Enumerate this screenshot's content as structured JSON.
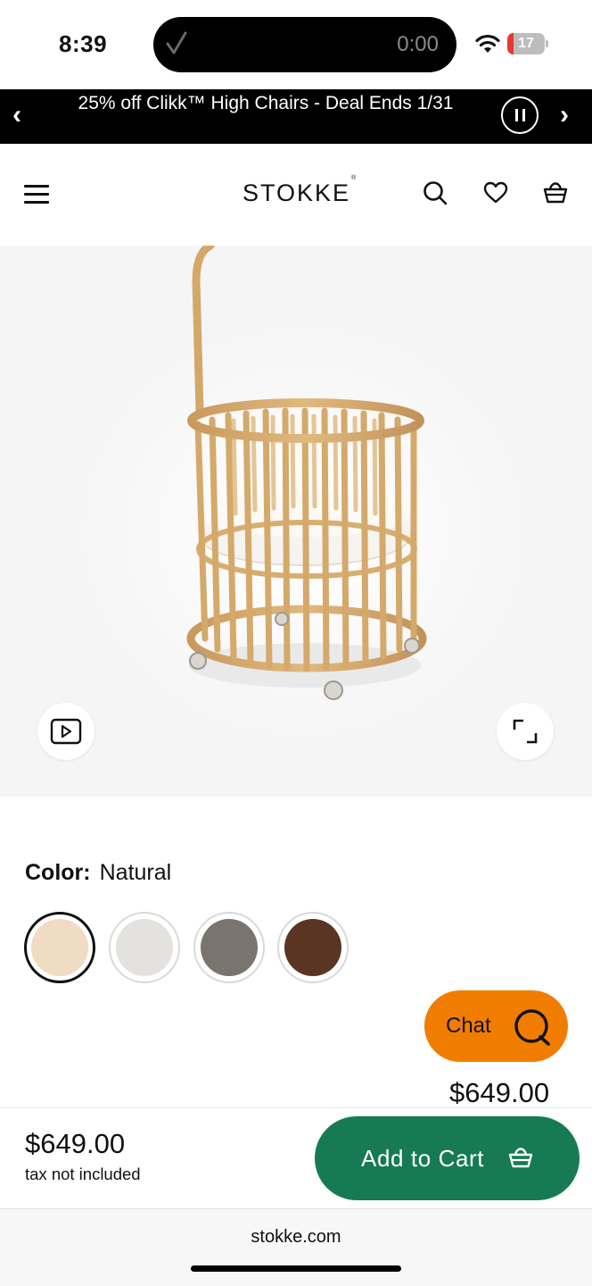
{
  "status_bar": {
    "time": "8:39",
    "timer": "0:00",
    "battery_level": "17",
    "battery_fraction": 0.17,
    "icons": [
      "checkmark-icon",
      "wifi-icon",
      "battery-icon"
    ]
  },
  "promo": {
    "text": "25% off Clikk™ High Chairs - Deal Ends 1/31",
    "prev_icon": "‹",
    "next_icon": "›"
  },
  "header": {
    "logo": "STOKKE",
    "logo_mark": "®",
    "icons": [
      "menu-icon",
      "search-icon",
      "heart-icon",
      "basket-icon"
    ]
  },
  "product": {
    "image_alt": "round wooden crib with canopy pole",
    "color_label": "Color:",
    "color_value": "Natural",
    "swatches": [
      {
        "name": "Natural",
        "color": "#f0dcc2",
        "selected": true
      },
      {
        "name": "White",
        "color": "#e4e2df",
        "selected": false
      },
      {
        "name": "Grey",
        "color": "#7a746e",
        "selected": false
      },
      {
        "name": "Walnut",
        "color": "#5a3524",
        "selected": false
      }
    ],
    "price_peek": "$649.00"
  },
  "chat": {
    "label": "Chat"
  },
  "cart_bar": {
    "price": "$649.00",
    "tax_note": "tax not included",
    "button_label": "Add to Cart"
  },
  "browser": {
    "url": "stokke.com"
  },
  "colors": {
    "promo_bg": "#000000",
    "chat_orange": "#f07d00",
    "cart_green": "#167b52"
  }
}
